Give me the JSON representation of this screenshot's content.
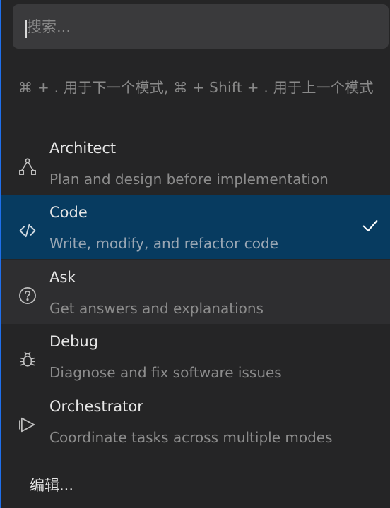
{
  "search": {
    "placeholder": "搜索..."
  },
  "hint": "⌘ + . 用于下一个模式, ⌘ + Shift + . 用于上一个模式",
  "modes": [
    {
      "name": "Architect",
      "description": "Plan and design before implementation",
      "icon": "architect-icon"
    },
    {
      "name": "Code",
      "description": "Write, modify, and refactor code",
      "icon": "code-icon",
      "selected": true
    },
    {
      "name": "Ask",
      "description": "Get answers and explanations",
      "icon": "question-icon"
    },
    {
      "name": "Debug",
      "description": "Diagnose and fix software issues",
      "icon": "bug-icon"
    },
    {
      "name": "Orchestrator",
      "description": "Coordinate tasks across multiple modes",
      "icon": "orchestrator-icon"
    }
  ],
  "footer": {
    "edit_label": "编辑..."
  },
  "colors": {
    "background": "#252526",
    "selected": "#073b60",
    "accent_border": "#1f6feb"
  }
}
